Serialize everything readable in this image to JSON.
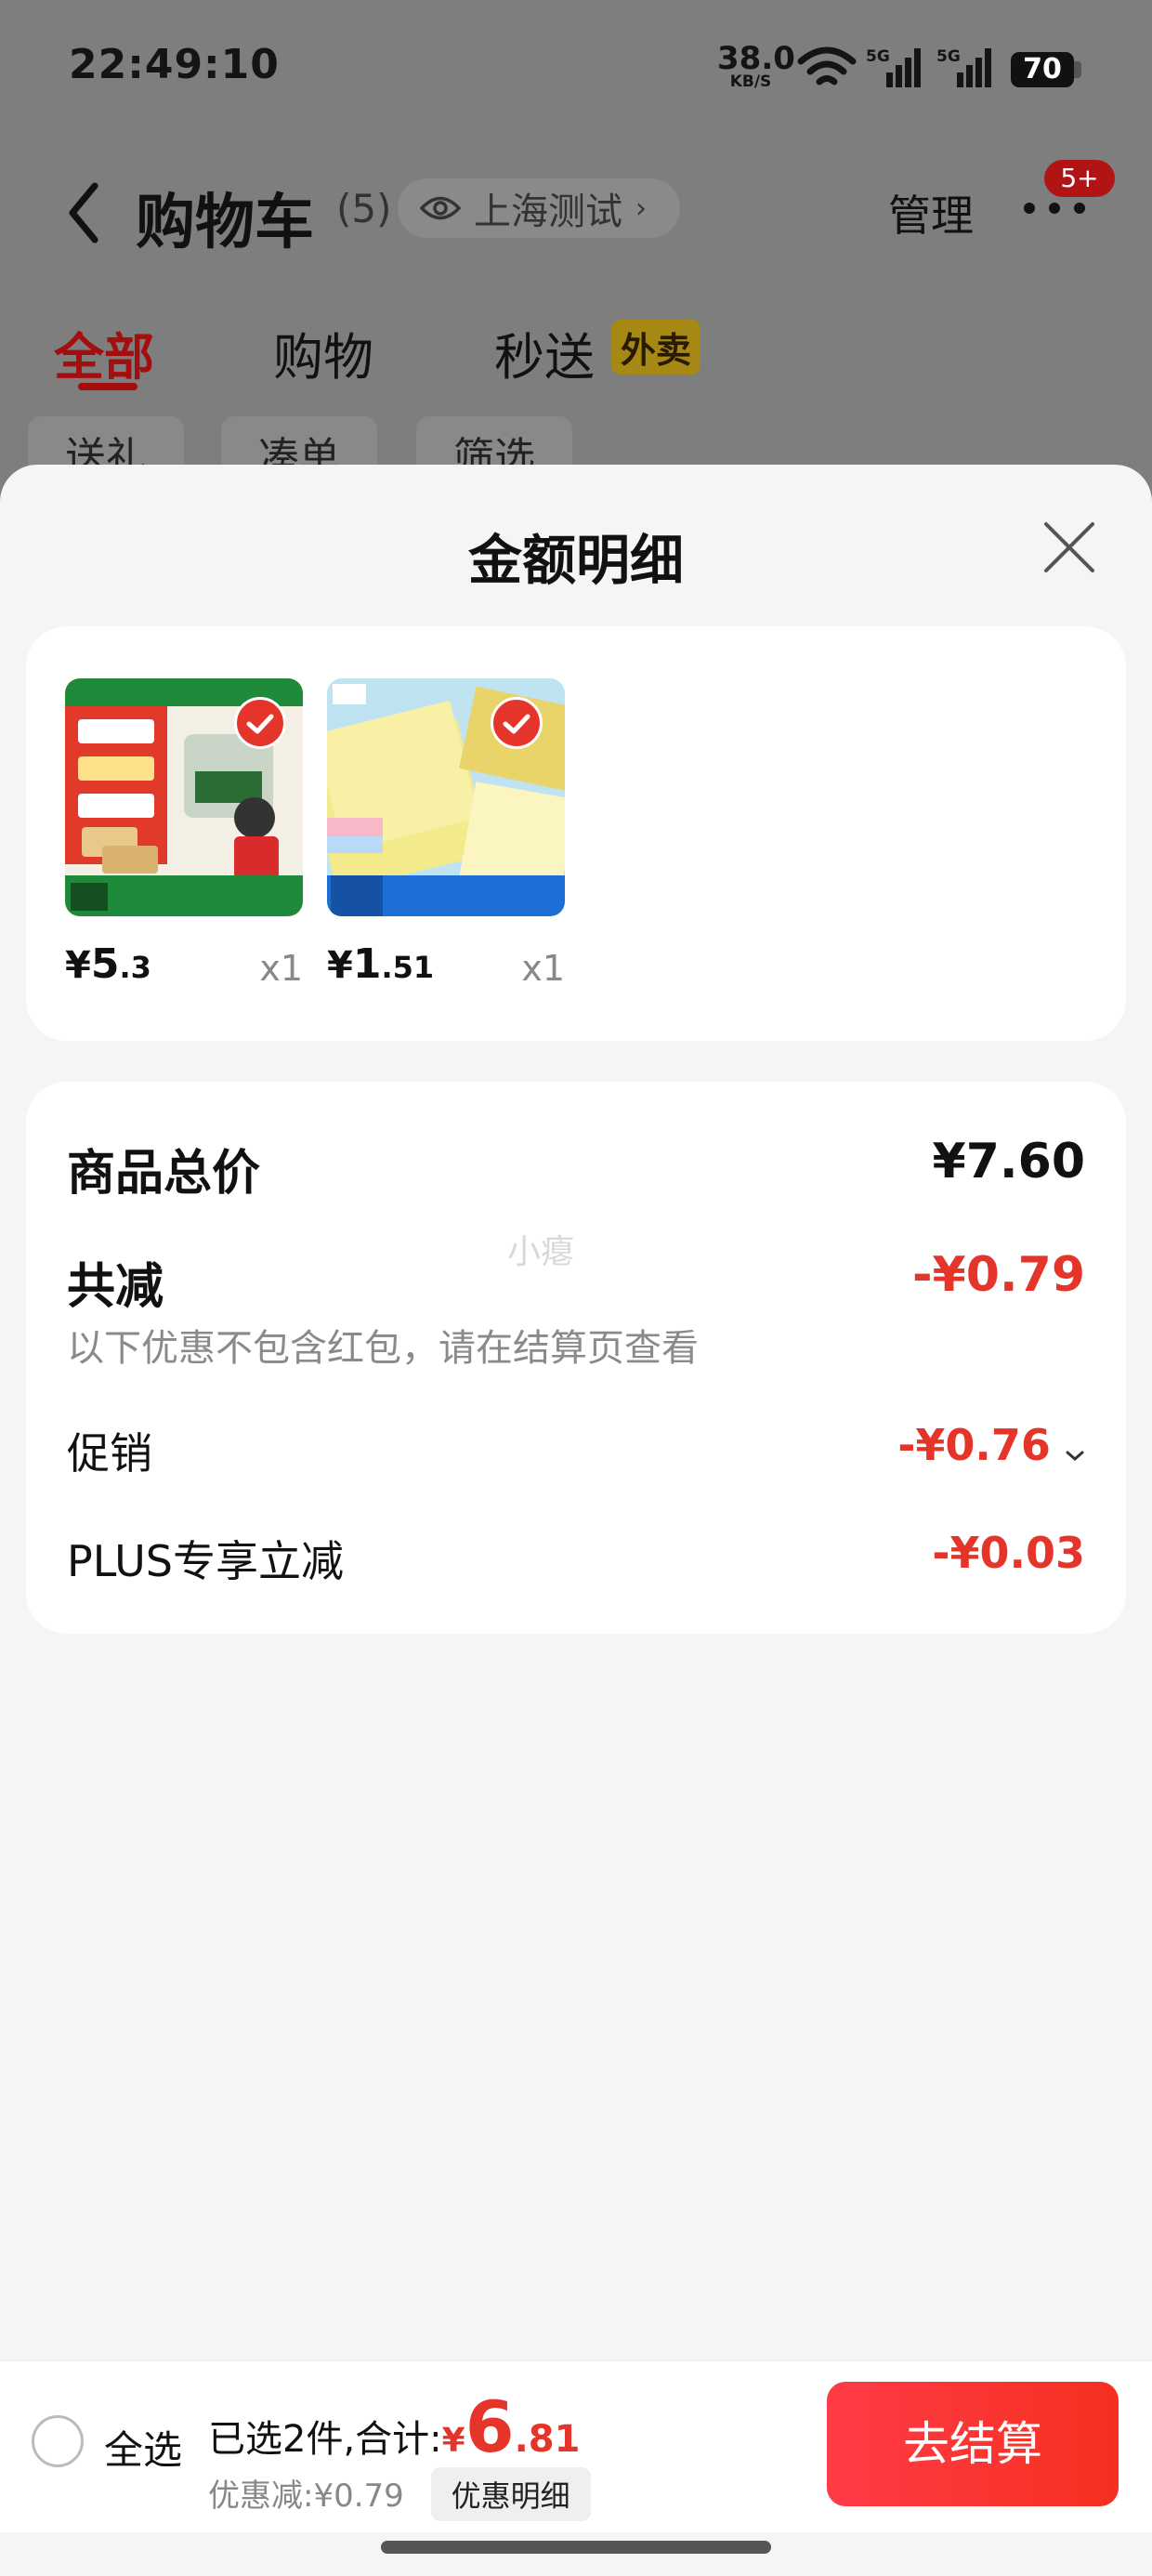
{
  "status_bar": {
    "time": "22:49:10",
    "net_speed_value": "38.0",
    "net_speed_unit": "KB/S",
    "battery": "70",
    "signal_label": "5G",
    "icons": [
      "wifi-icon",
      "signal-5g-icon",
      "battery-icon"
    ]
  },
  "header": {
    "title": "购物车",
    "count": "(5)",
    "location": "上海测试",
    "manage": "管理",
    "more_badge": "5+"
  },
  "tabs": [
    {
      "label": "全部",
      "active": true
    },
    {
      "label": "购物",
      "active": false
    },
    {
      "label": "秒送",
      "active": false,
      "tag": "外卖"
    }
  ],
  "filter_chips": [
    "送礼",
    "凑单",
    "筛选"
  ],
  "sheet": {
    "title": "金额明细",
    "products": [
      {
        "currency": "¥",
        "price_int": "5",
        "price_dec": ".3",
        "qty": "x1"
      },
      {
        "currency": "¥",
        "price_int": "1",
        "price_dec": ".51",
        "qty": "x1"
      }
    ],
    "summary": {
      "total_label": "商品总价",
      "total_value": "¥7.60",
      "reduce_label": "共减",
      "reduce_value": "-¥0.79",
      "reduce_note": "以下优惠不包含红包，请在结算页查看",
      "watermark": "小瘪",
      "promo_label": "促销",
      "promo_value": "-¥0.76",
      "plus_label": "PLUS专享立减",
      "plus_value": "-¥0.03"
    }
  },
  "footer": {
    "select_all": "全选",
    "selected_text": "已选2件,合计:",
    "total_currency": "¥",
    "total_int": "6",
    "total_dec": ".81",
    "discount_text": "优惠减:¥0.79",
    "detail_button": "优惠明细",
    "checkout": "去结算"
  },
  "colors": {
    "accent": "#e5342a",
    "checkout_start": "#ff3b47",
    "checkout_end": "#f6301f"
  }
}
